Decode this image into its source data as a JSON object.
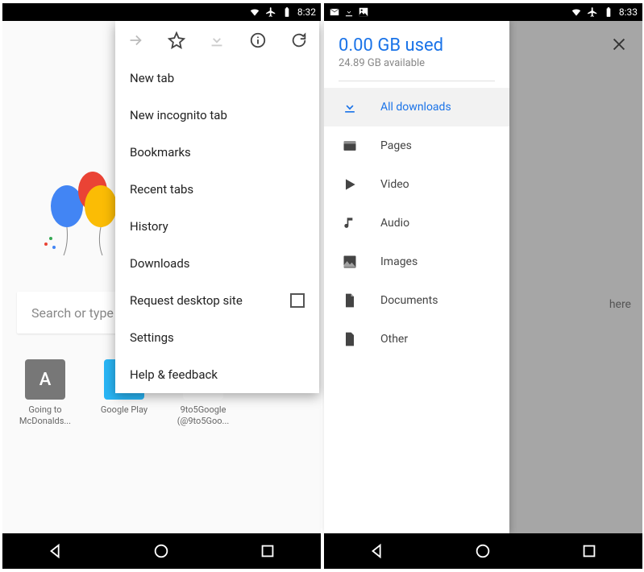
{
  "left": {
    "status": {
      "time": "8:32"
    },
    "search": {
      "placeholder": "Search or type UR"
    },
    "shortcuts": [
      {
        "letter": "A",
        "label_l1": "Going to",
        "label_l2": "McDonalds..."
      },
      {
        "letter": "",
        "label_l1": "Google Play",
        "label_l2": ""
      },
      {
        "letter": "",
        "label_l1": "9to5Google",
        "label_l2": "(@9to5Goo..."
      }
    ],
    "menu": {
      "items": [
        "New tab",
        "New incognito tab",
        "Bookmarks",
        "Recent tabs",
        "History",
        "Downloads",
        "Request desktop site",
        "Settings",
        "Help & feedback"
      ]
    }
  },
  "right": {
    "status": {
      "time": "8:33"
    },
    "storage": {
      "used": "0.00 GB used",
      "available": "24.89 GB available"
    },
    "categories": [
      "All downloads",
      "Pages",
      "Video",
      "Audio",
      "Images",
      "Documents",
      "Other"
    ],
    "empty_hint": "here"
  }
}
